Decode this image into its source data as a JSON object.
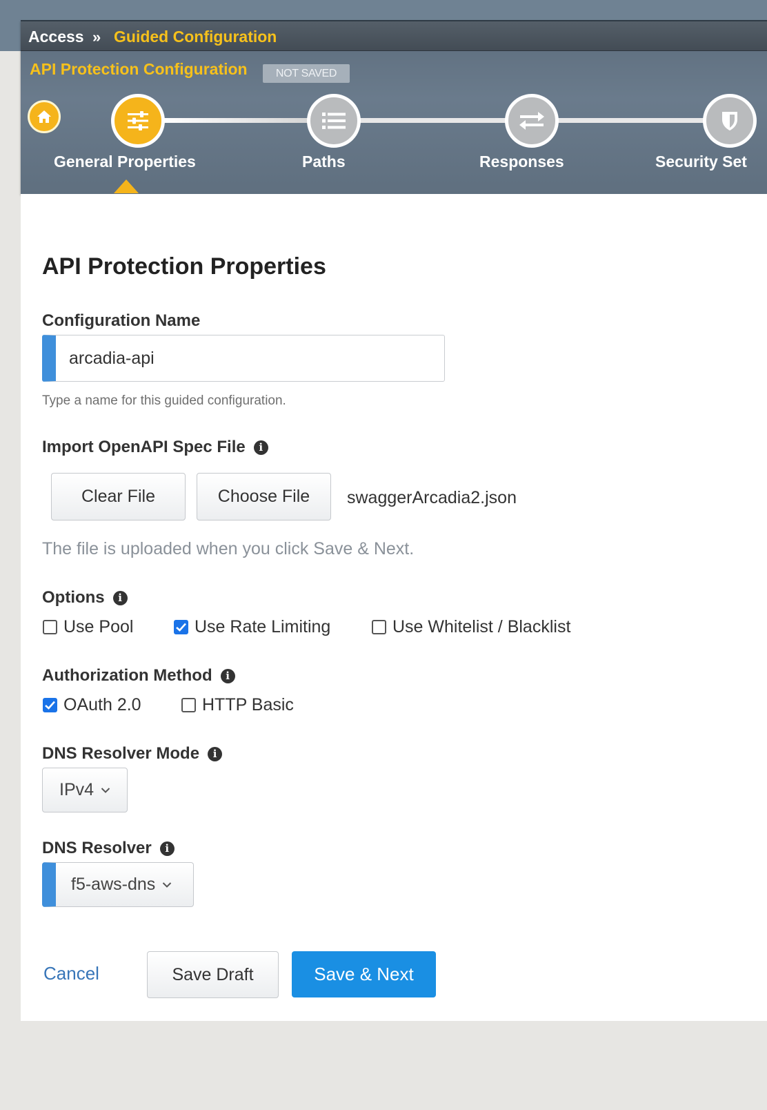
{
  "breadcrumb": {
    "root": "Access",
    "separator": "»",
    "current": "Guided Configuration"
  },
  "header": {
    "title": "API Protection Configuration",
    "status_badge": "NOT SAVED"
  },
  "wizard": {
    "steps": [
      {
        "label": "General Properties",
        "icon": "sliders-icon",
        "active": true
      },
      {
        "label": "Paths",
        "icon": "list-icon",
        "active": false
      },
      {
        "label": "Responses",
        "icon": "swap-arrows-icon",
        "active": false
      },
      {
        "label": "Security Set",
        "icon": "shield-icon",
        "active": false
      }
    ],
    "home_icon": "home-icon"
  },
  "form": {
    "title": "API Protection Properties",
    "config_name": {
      "label": "Configuration Name",
      "value": "arcadia-api",
      "help": "Type a name for this guided configuration."
    },
    "import_spec": {
      "label": "Import OpenAPI Spec File",
      "clear_label": "Clear File",
      "choose_label": "Choose File",
      "file_name": "swaggerArcadia2.json",
      "note": "The file is uploaded when you click Save & Next."
    },
    "options": {
      "label": "Options",
      "items": [
        {
          "label": "Use Pool",
          "checked": false
        },
        {
          "label": "Use Rate Limiting",
          "checked": true
        },
        {
          "label": "Use Whitelist / Blacklist",
          "checked": false
        }
      ]
    },
    "authorization": {
      "label": "Authorization Method",
      "items": [
        {
          "label": "OAuth 2.0",
          "checked": true
        },
        {
          "label": "HTTP Basic",
          "checked": false
        }
      ]
    },
    "dns_mode": {
      "label": "DNS Resolver Mode",
      "value": "IPv4"
    },
    "dns_resolver": {
      "label": "DNS Resolver",
      "value": "f5-aws-dns"
    }
  },
  "actions": {
    "cancel": "Cancel",
    "save_draft": "Save Draft",
    "save_next": "Save & Next"
  },
  "colors": {
    "accent_yellow": "#f5b41b",
    "primary_blue": "#1a8fe3",
    "required_marker": "#3f8fdb"
  }
}
